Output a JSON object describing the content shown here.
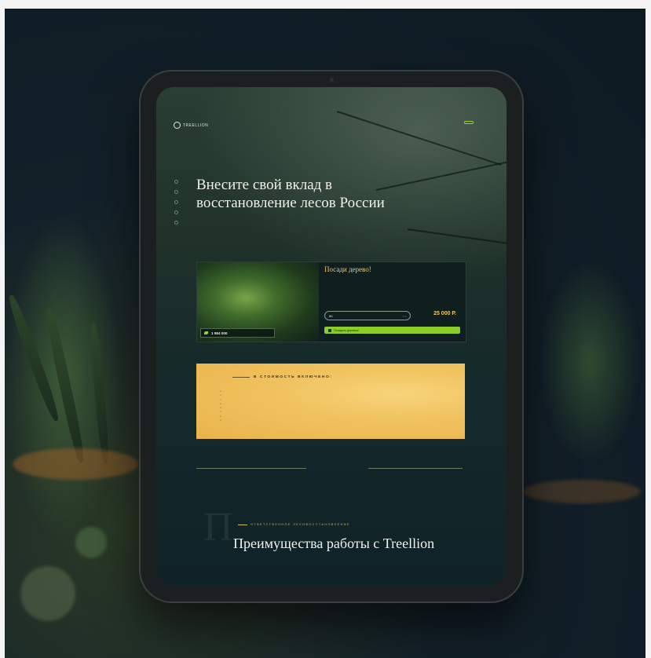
{
  "nav": {
    "logo": "TREELLION",
    "links": [
      "",
      "",
      "",
      ""
    ],
    "cta": ""
  },
  "hero": {
    "title": "Внесите свой вклад в восстановление лесов России",
    "text": ""
  },
  "plant_card": {
    "title": "Посади дерево!",
    "text": "",
    "counter_value": "1 984 000",
    "counter_label": "",
    "quantity_label": "",
    "cost_label": "",
    "quantity_value": "50",
    "price": "25 000 Р.",
    "button_label": "Посадить деревья!"
  },
  "included": {
    "title": "В СТОИМОСТЬ ВКЛЮЧЕНО:",
    "items": [
      "",
      "",
      "",
      "",
      "",
      "",
      "",
      ""
    ]
  },
  "advantages": {
    "tagline": "ОТВЕТСТВЕННОЕ ЛЕСОВОССТАНОВЛЕНИЕ",
    "title": "Преимущества работы с Treellion",
    "text": ""
  },
  "colors": {
    "accent_green": "#8ccd2a",
    "accent_gold": "#e8c979",
    "included_bg": "#f0c360"
  }
}
